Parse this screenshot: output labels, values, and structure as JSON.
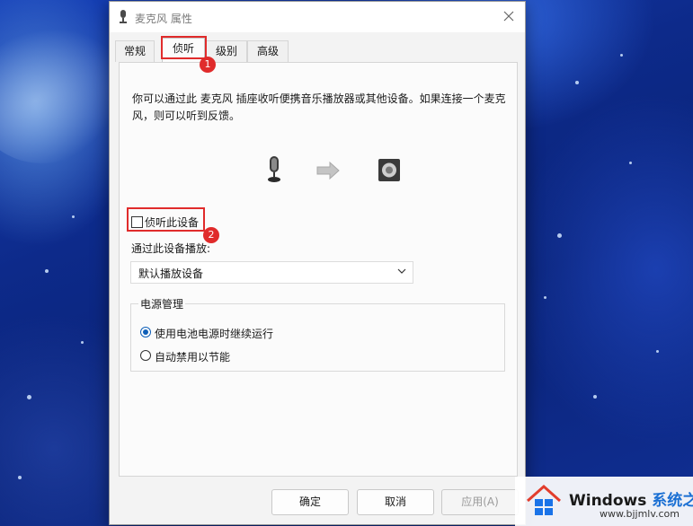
{
  "window": {
    "title": "麦克风 属性"
  },
  "tabs": [
    {
      "label": "常规"
    },
    {
      "label": "侦听"
    },
    {
      "label": "级别"
    },
    {
      "label": "高级"
    }
  ],
  "listen": {
    "description": "你可以通过此 麦克风 插座收听便携音乐播放器或其他设备。如果连接一个麦克风，则可以听到反馈。",
    "checkbox_label": "侦听此设备",
    "checkbox_checked": false,
    "playback_label": "通过此设备播放:",
    "playback_value": "默认播放设备"
  },
  "power": {
    "legend": "电源管理",
    "options": [
      {
        "label": "使用电池电源时继续运行",
        "selected": true
      },
      {
        "label": "自动禁用以节能",
        "selected": false
      }
    ]
  },
  "buttons": {
    "ok": "确定",
    "cancel": "取消",
    "apply": "应用(A)"
  },
  "annotations": [
    "1",
    "2"
  ],
  "watermark": {
    "brand": "Windows",
    "brand_cn": "系统之家",
    "url": "www.bjjmlv.com"
  },
  "colors": {
    "accent": "#0f5fb8",
    "annotation": "#e02b2b"
  }
}
